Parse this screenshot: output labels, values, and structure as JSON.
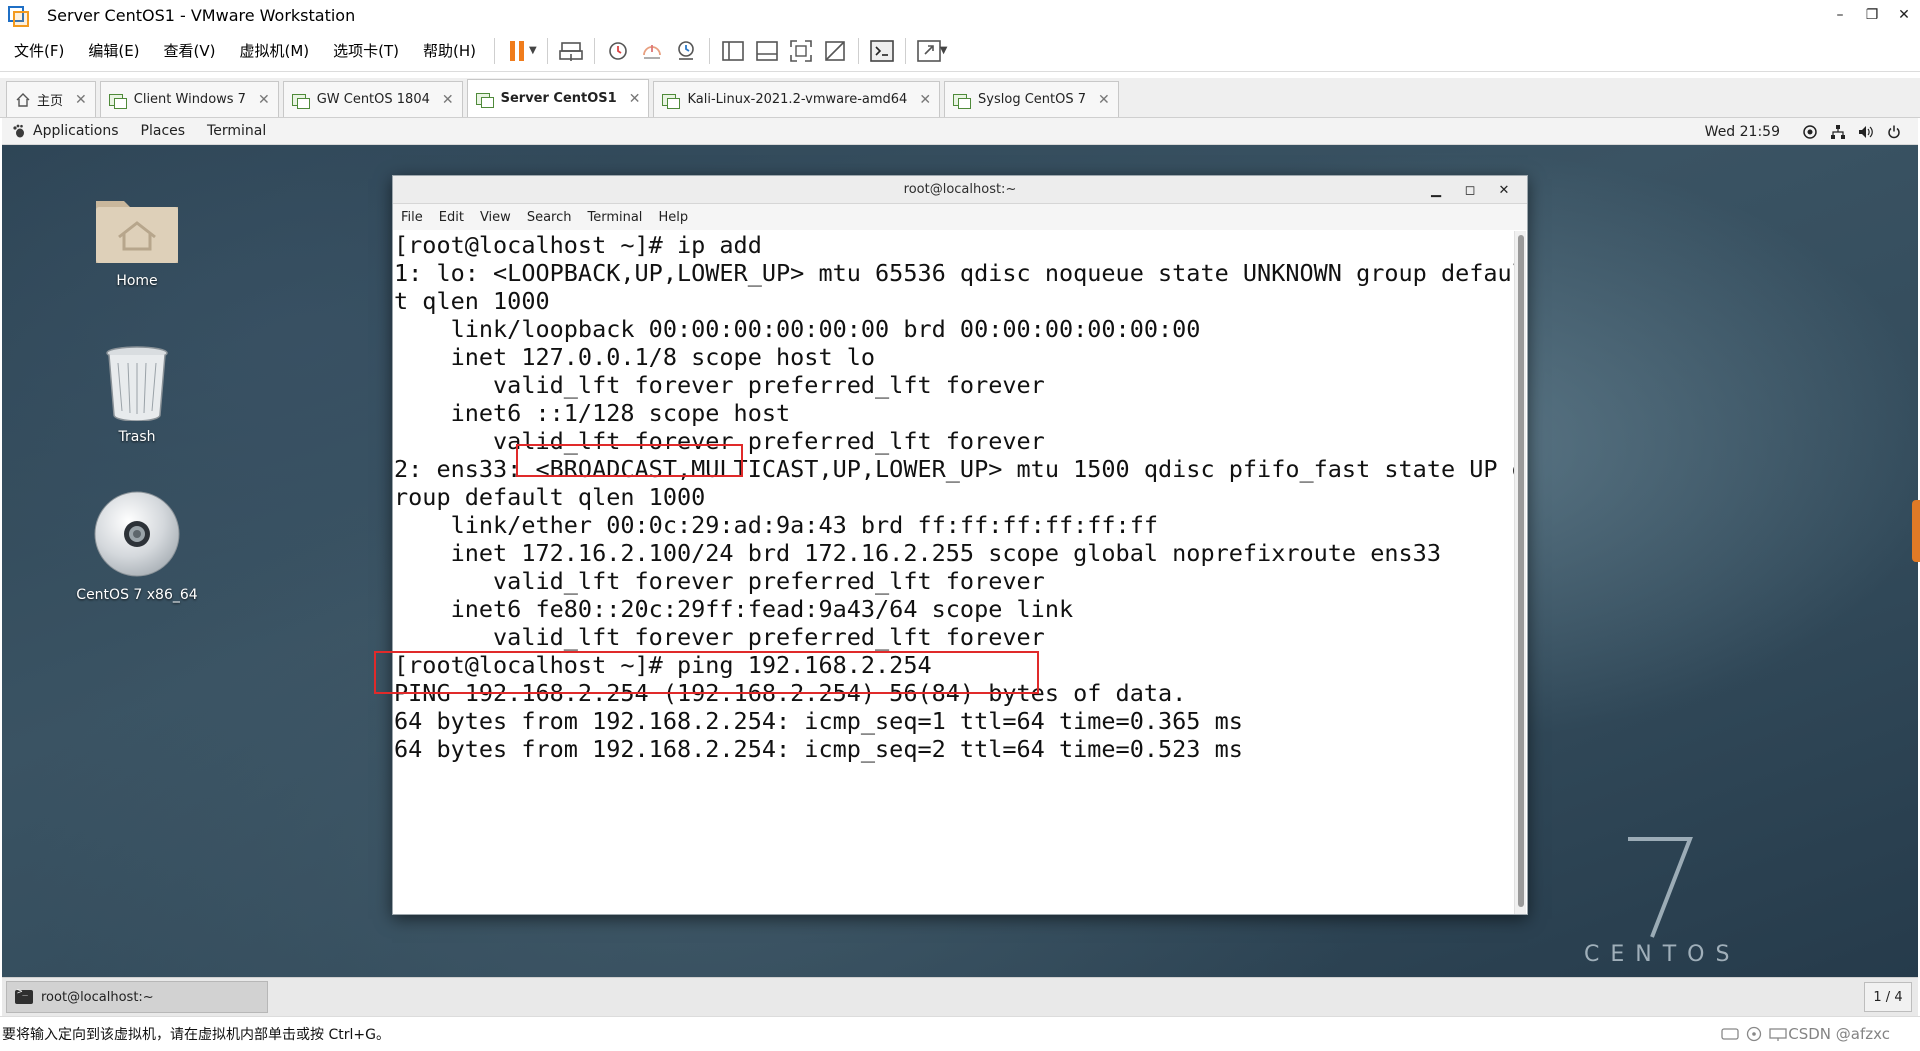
{
  "host": {
    "title": "Server CentOS1 - VMware Workstation",
    "window_controls": [
      "–",
      "❐",
      "✕"
    ],
    "menu": [
      "文件(F)",
      "编辑(E)",
      "查看(V)",
      "虚拟机(M)",
      "选项卡(T)",
      "帮助(H)"
    ],
    "tabs": [
      {
        "label": "主页",
        "kind": "home"
      },
      {
        "label": "Client Windows 7",
        "kind": "vm"
      },
      {
        "label": "GW CentOS 1804",
        "kind": "vm"
      },
      {
        "label": "Server CentOS1",
        "kind": "vm",
        "active": true
      },
      {
        "label": "Kali-Linux-2021.2-vmware-amd64",
        "kind": "vm"
      },
      {
        "label": "Syslog CentOS 7",
        "kind": "vm"
      }
    ],
    "status_hint": "要将输入定向到该虚拟机，请在虚拟机内部单击或按 Ctrl+G。",
    "watermark": "CSDN @afzxc"
  },
  "guest": {
    "topbar": {
      "applications": "Applications",
      "places": "Places",
      "terminal": "Terminal",
      "clock": "Wed 21:59"
    },
    "desktop_icons": [
      {
        "label": "Home",
        "icon": "home-folder-icon"
      },
      {
        "label": "Trash",
        "icon": "trash-icon"
      },
      {
        "label": "CentOS 7 x86_64",
        "icon": "disc-icon"
      }
    ],
    "branding": {
      "number": "7",
      "word": "CENTOS"
    },
    "taskbar": {
      "item": "root@localhost:~",
      "workspace": "1 / 4"
    }
  },
  "terminal": {
    "title": "root@localhost:~",
    "menu": [
      "File",
      "Edit",
      "View",
      "Search",
      "Terminal",
      "Help"
    ],
    "lines": [
      "[root@localhost ~]# ip add",
      "1: lo: <LOOPBACK,UP,LOWER_UP> mtu 65536 qdisc noqueue state UNKNOWN group defaul",
      "t qlen 1000",
      "    link/loopback 00:00:00:00:00:00 brd 00:00:00:00:00:00",
      "    inet 127.0.0.1/8 scope host lo",
      "       valid_lft forever preferred_lft forever",
      "    inet6 ::1/128 scope host",
      "       valid_lft forever preferred_lft forever",
      "2: ens33: <BROADCAST,MULTICAST,UP,LOWER_UP> mtu 1500 qdisc pfifo_fast state UP g",
      "roup default qlen 1000",
      "    link/ether 00:0c:29:ad:9a:43 brd ff:ff:ff:ff:ff:ff",
      "    inet 172.16.2.100/24 brd 172.16.2.255 scope global noprefixroute ens33",
      "       valid_lft forever preferred_lft forever",
      "    inet6 fe80::20c:29ff:fead:9a43/64 scope link",
      "       valid_lft forever preferred_lft forever",
      "[root@localhost ~]# ping 192.168.2.254",
      "PING 192.168.2.254 (192.168.2.254) 56(84) bytes of data.",
      "64 bytes from 192.168.2.254: icmp_seq=1 ttl=64 time=0.365 ms",
      "64 bytes from 192.168.2.254: icmp_seq=2 ttl=64 time=0.523 ms"
    ],
    "annotation_color": "#e02a2a"
  }
}
